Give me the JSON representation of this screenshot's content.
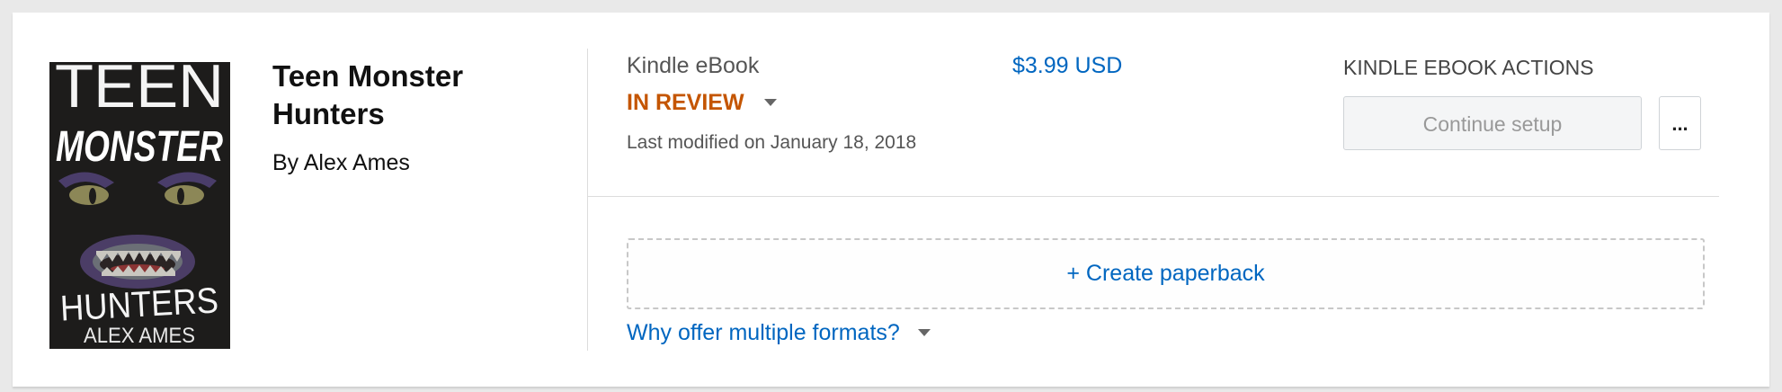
{
  "book": {
    "title": "Teen Monster Hunters",
    "author": "By Alex Ames",
    "cover": {
      "line1": "TEEN",
      "line2": "MONSTER",
      "line3": "HUNTERS",
      "line4": "ALEX AMES"
    }
  },
  "kindle": {
    "format": "Kindle eBook",
    "status": "IN REVIEW",
    "last_modified": "Last modified on January 18, 2018",
    "price": "$3.99 USD",
    "actions_heading": "KINDLE EBOOK ACTIONS",
    "continue_label": "Continue setup",
    "more_label": "..."
  },
  "paperback": {
    "create_label": "+ Create paperback",
    "why_label": "Why offer multiple formats?"
  },
  "colors": {
    "status": "#c45500",
    "link": "#0066c0",
    "background": "#e9e9e9"
  }
}
